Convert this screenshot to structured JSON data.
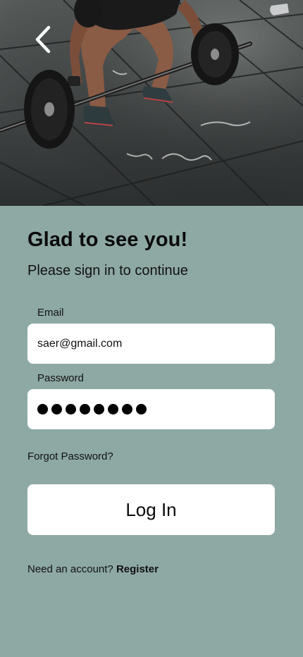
{
  "hero": {
    "back_icon": "chevron-left-icon",
    "photo_subject": "weightlifter-barbell-photo"
  },
  "form": {
    "heading": "Glad to see you!",
    "subheading": "Please sign in to continue",
    "email": {
      "label": "Email",
      "value": "saer@gmail.com"
    },
    "password": {
      "label": "Password",
      "masked_length": 8
    },
    "forgot_label": "Forgot Password?",
    "login_label": "Log In",
    "register_prompt": "Need an account?",
    "register_link": "Register"
  },
  "colors": {
    "background": "#8ea9a4",
    "field": "#ffffff",
    "text": "#111111"
  }
}
